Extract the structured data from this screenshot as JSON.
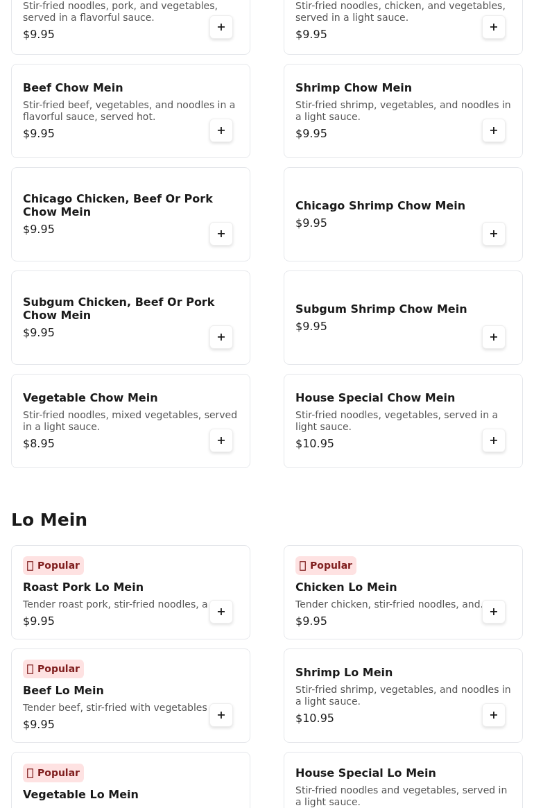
{
  "sections": [
    {
      "items": [
        {
          "description": "Stir-fried noodles, pork, and vegetables, served in a flavorful sauce.",
          "price": "$9.95",
          "add": "+"
        },
        {
          "description": "Stir-fried noodles, chicken, and vegetables, served in a light sauce.",
          "price": "$9.95",
          "add": "+"
        },
        {
          "name": "Beef Chow Mein",
          "description": "Stir-fried beef, vegetables, and noodles in a flavorful sauce, served hot.",
          "price": "$9.95",
          "add": "+"
        },
        {
          "name": "Shrimp Chow Mein",
          "description": "Stir-fried shrimp, vegetables, and noodles in a light sauce.",
          "price": "$9.95",
          "add": "+"
        },
        {
          "name": "Chicago Chicken, Beef Or Pork Chow Mein",
          "price": "$9.95",
          "add": "+"
        },
        {
          "name": "Chicago Shrimp Chow Mein",
          "price": "$9.95",
          "add": "+"
        },
        {
          "name": "Subgum Chicken, Beef Or Pork Chow Mein",
          "price": "$9.95",
          "add": "+"
        },
        {
          "name": "Subgum Shrimp Chow Mein",
          "price": "$9.95",
          "add": "+"
        },
        {
          "name": "Vegetable Chow Mein",
          "description": "Stir-fried noodles, mixed vegetables, served in a light sauce.",
          "price": "$8.95",
          "add": "+"
        },
        {
          "name": "House Special Chow Mein",
          "description": "Stir-fried noodles, vegetables, served in a light sauce.",
          "price": "$10.95",
          "add": "+"
        }
      ]
    },
    {
      "title": "Lo Mein",
      "items": [
        {
          "badge": "Popular",
          "name": "Roast Pork Lo Mein",
          "description": "Tender roast pork, stir-fried noodles, a",
          "price": "$9.95",
          "add": "+"
        },
        {
          "badge": "Popular",
          "name": "Chicken Lo Mein",
          "description": "Tender chicken, stir-fried noodles, and.",
          "price": "$9.95",
          "add": "+"
        },
        {
          "badge": "Popular",
          "name": "Beef Lo Mein",
          "description": "Tender beef, stir-fried with vegetables",
          "price": "$9.95",
          "add": "+"
        },
        {
          "name": "Shrimp Lo Mein",
          "description": "Stir-fried shrimp, vegetables, and noodles in a light sauce.",
          "price": "$10.95",
          "add": "+"
        },
        {
          "badge": "Popular",
          "name": "Vegetable Lo Mein"
        },
        {
          "name": "House Special Lo Mein",
          "description": "Stir-fried noodles and vegetables, served in a light sauce."
        }
      ]
    }
  ]
}
